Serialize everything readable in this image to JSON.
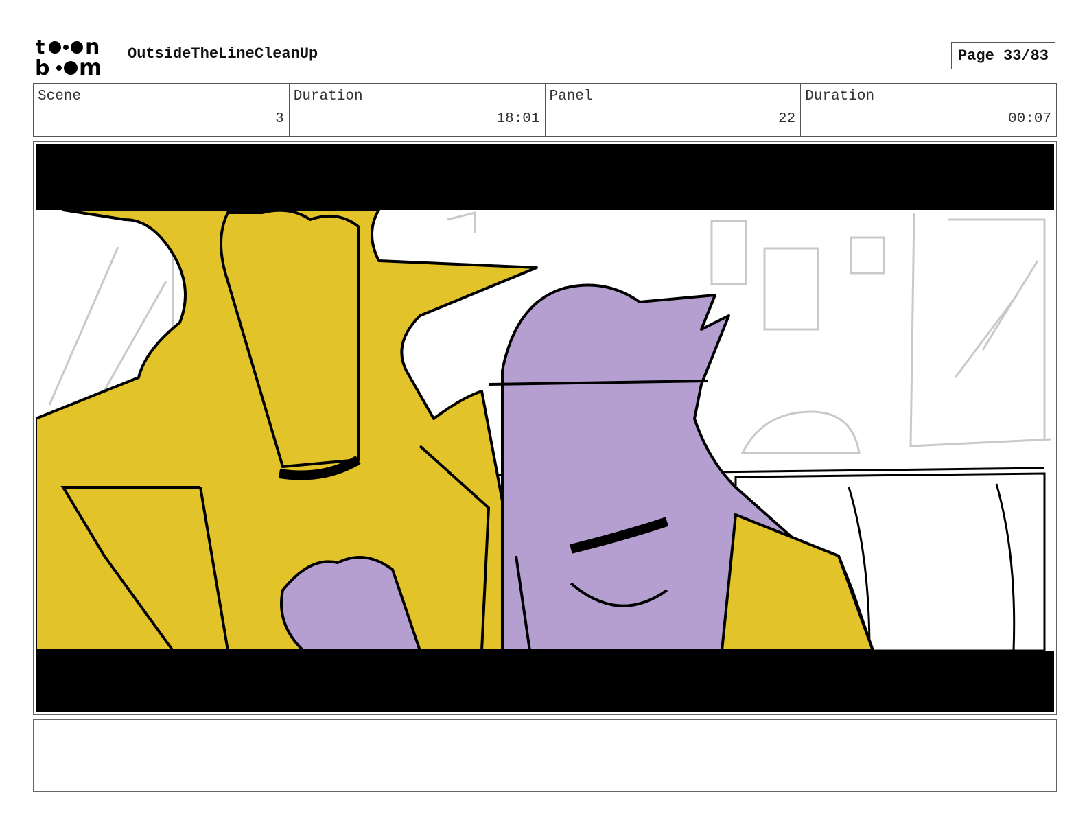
{
  "header": {
    "logo_text": "toon boom",
    "project_title": "OutsideTheLineCleanUp",
    "page_indicator": "Page 33/83"
  },
  "info": {
    "scene_label": "Scene",
    "scene_value": "3",
    "scene_duration_label": "Duration",
    "scene_duration_value": "18:01",
    "panel_label": "Panel",
    "panel_value": "22",
    "panel_duration_label": "Duration",
    "panel_duration_value": "00:07"
  },
  "panel": {
    "colors": {
      "yellow": "#e2c42a",
      "purple": "#b49fd0",
      "letterbox": "#000000",
      "sketch": "#c9c9c9"
    }
  },
  "notes": {
    "text": ""
  }
}
